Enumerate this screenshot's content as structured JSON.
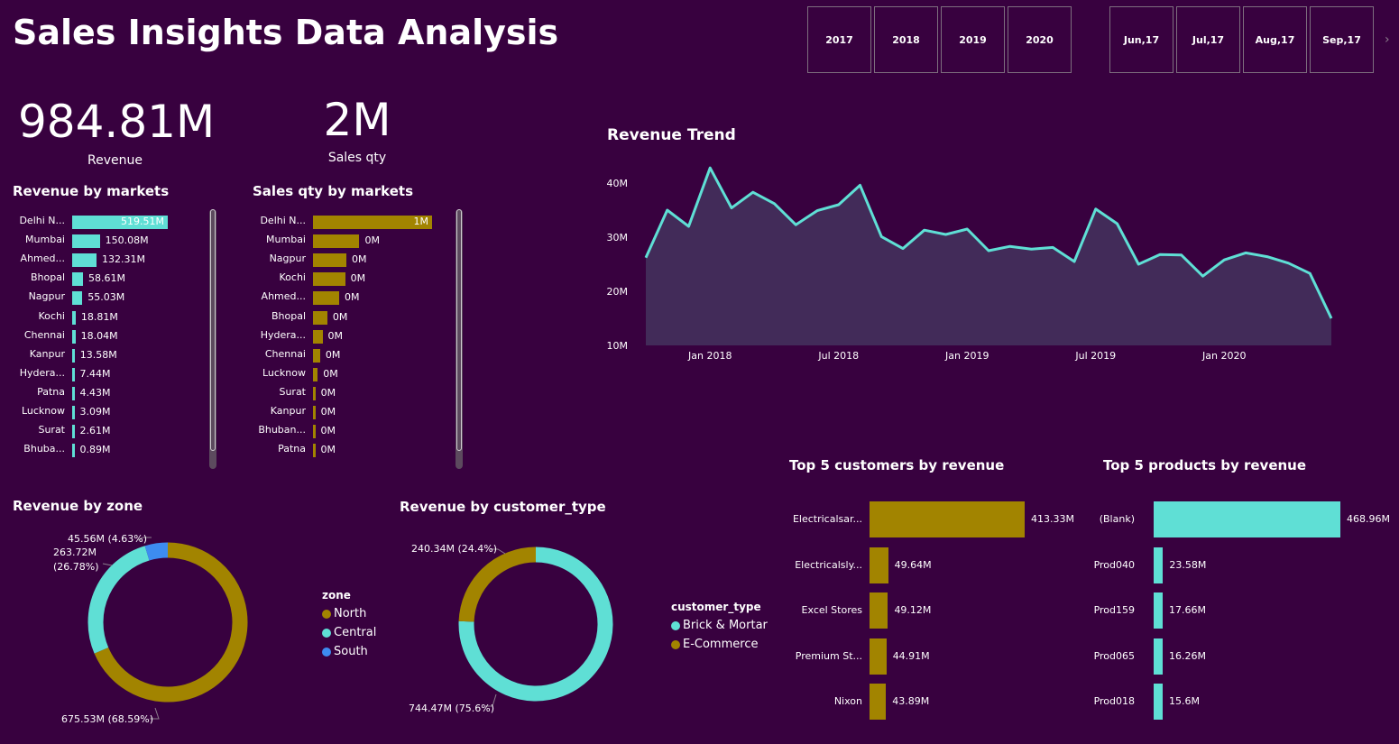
{
  "page": {
    "title": "Sales Insights Data Analysis"
  },
  "year_slicer": [
    "2017",
    "2018",
    "2019",
    "2020"
  ],
  "month_slicer": [
    "Jun,17",
    "Jul,17",
    "Aug,17",
    "Sep,17"
  ],
  "slicer_next_icon": "chevron-right-icon",
  "kpis": {
    "revenue_value": "984.81M",
    "revenue_label": "Revenue",
    "qty_value": "2M",
    "qty_label": "Sales qty"
  },
  "colors": {
    "background": "#38013f",
    "cyan": "#5fdfd5",
    "gold": "#a28400",
    "blue": "#3d8cf0",
    "area_fill": "#422b59"
  },
  "chart_data": [
    {
      "id": "revenue_by_markets",
      "type": "bar",
      "title": "Revenue by markets",
      "categories": [
        "Delhi N...",
        "Mumbai",
        "Ahmed...",
        "Bhopal",
        "Nagpur",
        "Kochi",
        "Chennai",
        "Kanpur",
        "Hydera...",
        "Patna",
        "Lucknow",
        "Surat",
        "Bhuba..."
      ],
      "values": [
        519.51,
        150.08,
        132.31,
        58.61,
        55.03,
        18.81,
        18.04,
        13.58,
        7.44,
        4.43,
        3.09,
        2.61,
        0.89
      ],
      "labels": [
        "519.51M",
        "150.08M",
        "132.31M",
        "58.61M",
        "55.03M",
        "18.81M",
        "18.04M",
        "13.58M",
        "7.44M",
        "4.43M",
        "3.09M",
        "2.61M",
        "0.89M"
      ],
      "color": "#5fdfd5"
    },
    {
      "id": "sales_qty_by_markets",
      "type": "bar",
      "title": "Sales qty by markets",
      "categories": [
        "Delhi N...",
        "Mumbai",
        "Nagpur",
        "Kochi",
        "Ahmed...",
        "Bhopal",
        "Hydera...",
        "Chennai",
        "Lucknow",
        "Surat",
        "Kanpur",
        "Bhuban...",
        "Patna"
      ],
      "values": [
        1.0,
        0.39,
        0.28,
        0.27,
        0.22,
        0.12,
        0.08,
        0.06,
        0.04,
        0.02,
        0.02,
        0.01,
        0.01
      ],
      "labels": [
        "1M",
        "0M",
        "0M",
        "0M",
        "0M",
        "0M",
        "0M",
        "0M",
        "0M",
        "0M",
        "0M",
        "0M",
        "0M"
      ],
      "color": "#a28400"
    },
    {
      "id": "revenue_trend",
      "type": "area",
      "title": "Revenue Trend",
      "x_ticks": [
        "Jan 2018",
        "Jul 2018",
        "Jan 2019",
        "Jul 2019",
        "Jan 2020"
      ],
      "y_ticks": [
        "10M",
        "20M",
        "30M",
        "40M"
      ],
      "ylim": [
        10,
        45
      ],
      "x": [
        "Oct 2017",
        "Nov 2017",
        "Dec 2017",
        "Jan 2018",
        "Feb 2018",
        "Mar 2018",
        "Apr 2018",
        "May 2018",
        "Jun 2018",
        "Jul 2018",
        "Aug 2018",
        "Sep 2018",
        "Oct 2018",
        "Nov 2018",
        "Dec 2018",
        "Jan 2019",
        "Feb 2019",
        "Mar 2019",
        "Apr 2019",
        "May 2019",
        "Jun 2019",
        "Jul 2019",
        "Aug 2019",
        "Sep 2019",
        "Oct 2019",
        "Nov 2019",
        "Dec 2019",
        "Jan 2020",
        "Feb 2020",
        "Mar 2020",
        "Apr 2020",
        "May 2020",
        "Jun 2020"
      ],
      "values": [
        26.2,
        35.0,
        32.0,
        42.8,
        35.4,
        38.3,
        36.2,
        32.3,
        34.9,
        36.0,
        39.6,
        30.1,
        27.9,
        31.3,
        30.5,
        31.5,
        27.5,
        28.3,
        27.8,
        28.1,
        25.5,
        35.2,
        32.5,
        25.0,
        26.8,
        26.7,
        22.8,
        25.8,
        27.1,
        26.4,
        25.2,
        23.3,
        15.0
      ],
      "color": "#5fdfd5"
    },
    {
      "id": "revenue_by_zone",
      "type": "pie",
      "title": "Revenue by zone",
      "legend_title": "zone",
      "slices": [
        {
          "name": "North",
          "value": 675.53,
          "label": "675.53M (68.59%)",
          "color": "#a28400"
        },
        {
          "name": "Central",
          "value": 263.72,
          "label_line1": "263.72M",
          "label_line2": "(26.78%)",
          "color": "#5fdfd5"
        },
        {
          "name": "South",
          "value": 45.56,
          "label": "45.56M (4.63%)",
          "color": "#3d8cf0"
        }
      ]
    },
    {
      "id": "revenue_by_customer_type",
      "type": "pie",
      "title": "Revenue by customer_type",
      "legend_title": "customer_type",
      "slices": [
        {
          "name": "Brick & Mortar",
          "value": 744.47,
          "label": "744.47M (75.6%)",
          "color": "#5fdfd5"
        },
        {
          "name": "E-Commerce",
          "value": 240.34,
          "label": "240.34M (24.4%)",
          "color": "#a28400"
        }
      ]
    },
    {
      "id": "top5_customers",
      "type": "bar",
      "title": "Top 5 customers by revenue",
      "categories": [
        "Electricalsar...",
        "Electricalsly...",
        "Excel Stores",
        "Premium St...",
        "Nixon"
      ],
      "values": [
        413.33,
        49.64,
        49.12,
        44.91,
        43.89
      ],
      "labels": [
        "413.33M",
        "49.64M",
        "49.12M",
        "44.91M",
        "43.89M"
      ],
      "color": "#a28400"
    },
    {
      "id": "top5_products",
      "type": "bar",
      "title": "Top 5 products by revenue",
      "categories": [
        "(Blank)",
        "Prod040",
        "Prod159",
        "Prod065",
        "Prod018"
      ],
      "values": [
        468.96,
        23.58,
        17.66,
        16.26,
        15.6
      ],
      "labels": [
        "468.96M",
        "23.58M",
        "17.66M",
        "16.26M",
        "15.6M"
      ],
      "color": "#5fdfd5"
    }
  ]
}
